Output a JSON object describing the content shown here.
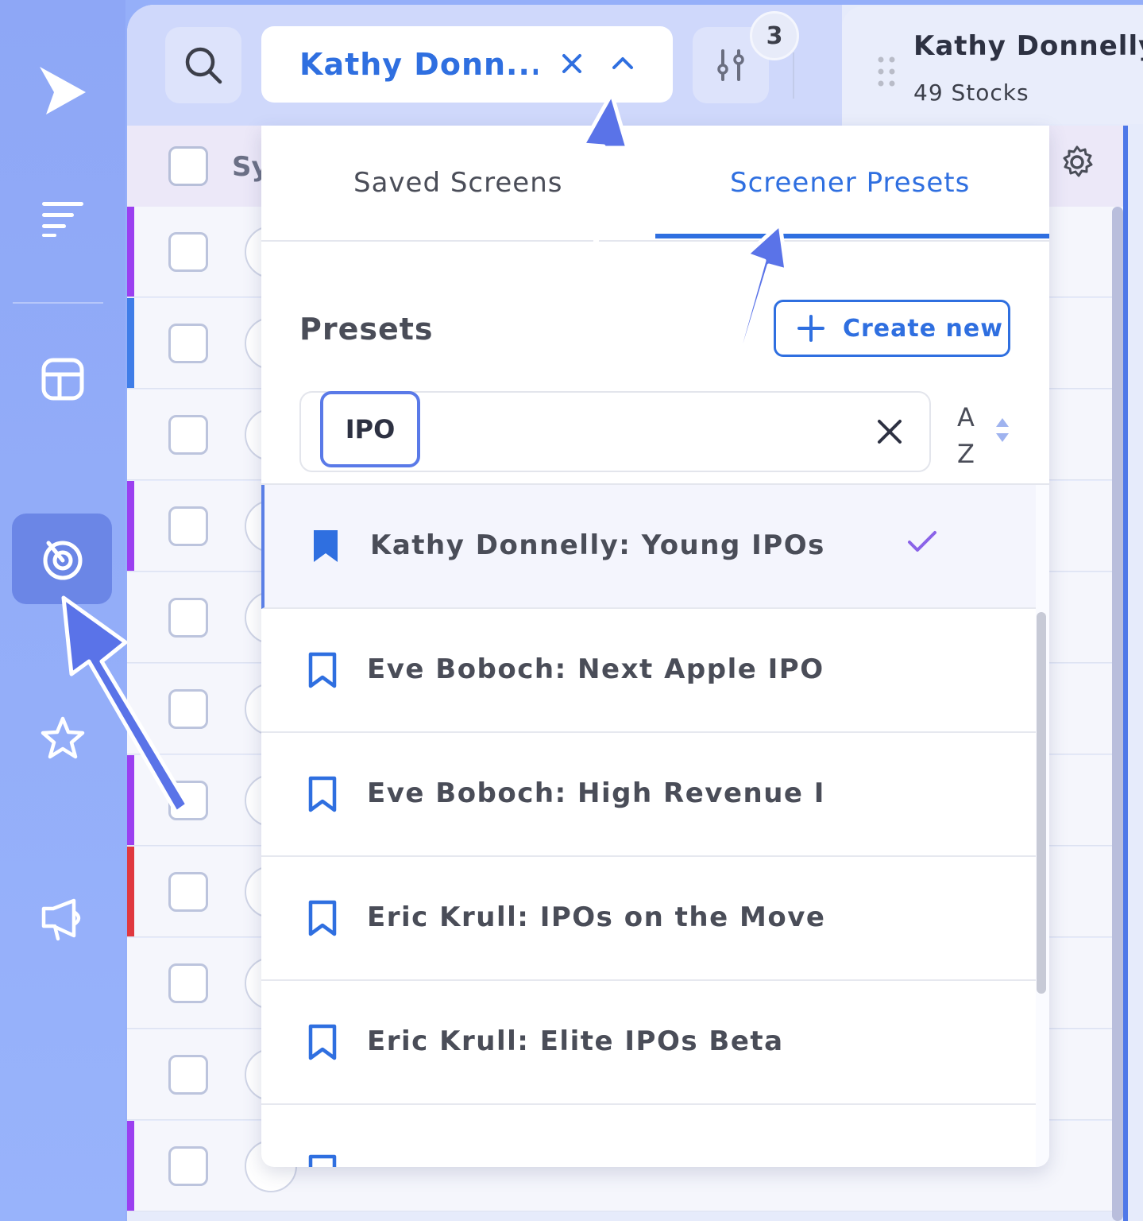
{
  "topbar": {
    "selected_screen": "Kathy Donn...",
    "filter_count": "3"
  },
  "summary": {
    "title": "Kathy Donnelly:",
    "subtitle": "49 Stocks"
  },
  "table": {
    "header_symbol": "Sy",
    "row_bar_colors": [
      "#9b3ff0",
      "#3f7de8",
      "",
      "#9b3ff0",
      "",
      "",
      "#9b3ff0",
      "#e0383f",
      "",
      "",
      "#9b3ff0"
    ]
  },
  "dropdown": {
    "tabs": [
      {
        "label": "Saved Screens",
        "active": false
      },
      {
        "label": "Screener Presets",
        "active": true
      }
    ],
    "heading": "Presets",
    "create_label": "Create new",
    "search_value": "IPO",
    "sort_top": "A",
    "sort_bottom": "Z",
    "items": [
      {
        "label": "Kathy Donnelly: Young IPOs",
        "selected": true
      },
      {
        "label": "Eve Boboch: Next Apple IPO",
        "selected": false
      },
      {
        "label": "Eve Boboch: High Revenue IPOs",
        "selected": false
      },
      {
        "label": "Eric Krull: IPOs on the Move Bet",
        "selected": false
      },
      {
        "label": "Eric Krull: Elite IPOs Beta",
        "selected": false
      }
    ]
  },
  "colors": {
    "accent": "#2f6fe0",
    "check": "#8a63e8",
    "annotation_arrow": "#5a73e8"
  }
}
